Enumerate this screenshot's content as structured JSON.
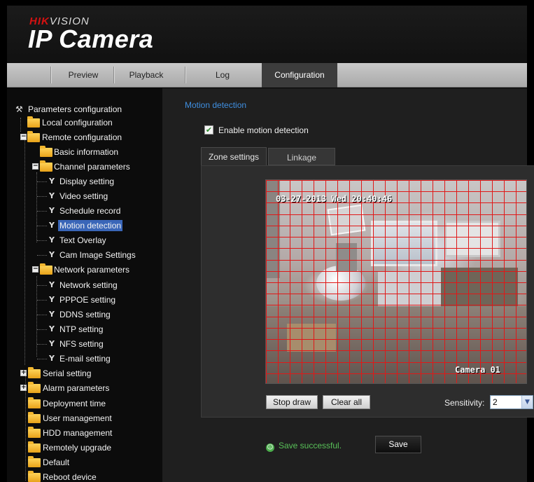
{
  "header": {
    "brand": "HIK",
    "brand_accent": "VISION",
    "product": "IP Camera"
  },
  "nav": {
    "tabs": [
      {
        "label": "Preview"
      },
      {
        "label": "Playback"
      },
      {
        "label": "Log"
      },
      {
        "label": "Configuration",
        "active": true
      }
    ]
  },
  "sidebar": {
    "root": "Parameters configuration",
    "items": [
      {
        "label": "Local configuration"
      },
      {
        "label": "Remote configuration"
      },
      {
        "label": "Basic information"
      },
      {
        "label": "Channel parameters"
      },
      {
        "label": "Display setting"
      },
      {
        "label": "Video setting"
      },
      {
        "label": "Schedule record"
      },
      {
        "label": "Motion detection",
        "selected": true
      },
      {
        "label": "Text Overlay"
      },
      {
        "label": "Cam Image Settings"
      },
      {
        "label": "Network parameters"
      },
      {
        "label": "Network setting"
      },
      {
        "label": "PPPOE setting"
      },
      {
        "label": "DDNS setting"
      },
      {
        "label": "NTP setting"
      },
      {
        "label": "NFS setting"
      },
      {
        "label": "E-mail setting"
      },
      {
        "label": "Serial setting"
      },
      {
        "label": "Alarm parameters"
      },
      {
        "label": "Deployment time"
      },
      {
        "label": "User management"
      },
      {
        "label": "HDD management"
      },
      {
        "label": "Remotely upgrade"
      },
      {
        "label": "Default"
      },
      {
        "label": "Reboot device"
      }
    ]
  },
  "main": {
    "section_title": "Motion detection",
    "enable_label": "Enable motion detection",
    "enable_checked": true,
    "tabs": [
      {
        "label": "Zone settings",
        "active": true
      },
      {
        "label": "Linkage"
      }
    ],
    "video": {
      "timestamp": "03-27-2013 Wed 20:40:46",
      "camera_name": "Camera 01"
    },
    "buttons": {
      "stop_draw": "Stop draw",
      "clear_all": "Clear all",
      "save": "Save"
    },
    "sensitivity": {
      "label": "Sensitivity:",
      "value": "2"
    },
    "status": "Save successful."
  },
  "colors": {
    "grid": "#e01818",
    "link": "#3f8fe0",
    "selection": "#3a66b8",
    "success": "#58c058"
  }
}
